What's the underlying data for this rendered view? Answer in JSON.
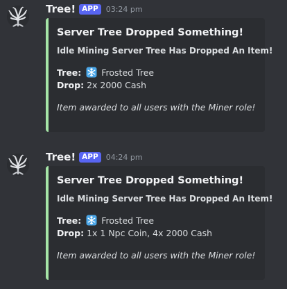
{
  "messages": [
    {
      "username": "Tree!",
      "badge": "APP",
      "timestamp": "03:24 pm",
      "avatar_icon": "tree-avatar-icon",
      "embed": {
        "accent_color": "#a6e5a7",
        "title": "Server Tree Dropped Something!",
        "subtitle": "Idle Mining Server Tree Has Dropped An Item!",
        "tree_label": "Tree:",
        "tree_icon": "snowflake-icon",
        "tree_value": "Frosted Tree",
        "drop_label": "Drop:",
        "drop_value": "2x 2000 Cash",
        "note": "Item awarded to all users with the Miner role!"
      }
    },
    {
      "username": "Tree!",
      "badge": "APP",
      "timestamp": "04:24 pm",
      "avatar_icon": "tree-avatar-icon",
      "embed": {
        "accent_color": "#a6e5a7",
        "title": "Server Tree Dropped Something!",
        "subtitle": "Idle Mining Server Tree Has Dropped An Item!",
        "tree_label": "Tree:",
        "tree_icon": "snowflake-icon",
        "tree_value": "Frosted Tree",
        "drop_label": "Drop:",
        "drop_value": "1x 1 Npc Coin, 4x 2000 Cash",
        "note": "Item awarded to all users with the Miner role!"
      }
    }
  ],
  "colors": {
    "background": "#313338",
    "embed_background": "#2b2d31",
    "badge": "#5865f2",
    "timestamp": "#949ba4"
  }
}
